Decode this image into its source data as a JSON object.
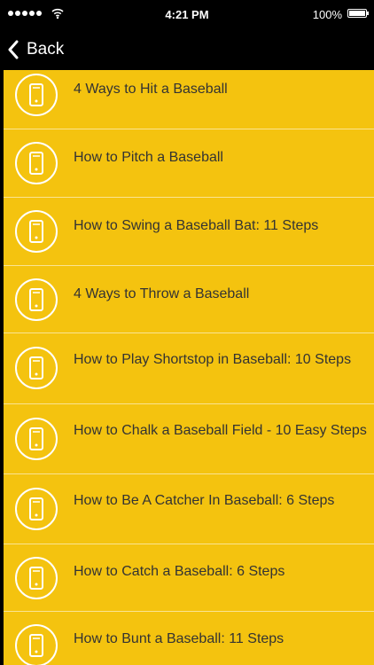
{
  "status_bar": {
    "time": "4:21 PM",
    "battery": "100%"
  },
  "nav": {
    "back_label": "Back"
  },
  "items": [
    {
      "label": "4 Ways to Hit a Baseball"
    },
    {
      "label": "How to Pitch a Baseball"
    },
    {
      "label": "How to Swing a Baseball Bat: 11 Steps"
    },
    {
      "label": "4 Ways to Throw a Baseball"
    },
    {
      "label": "How to Play Shortstop in Baseball: 10 Steps"
    },
    {
      "label": "How to Chalk a Baseball Field - 10 Easy Steps"
    },
    {
      "label": "How to Be A Catcher In Baseball: 6 Steps"
    },
    {
      "label": "How to Catch a Baseball: 6 Steps"
    },
    {
      "label": "How to Bunt a Baseball: 11 Steps"
    }
  ],
  "colors": {
    "list_background": "#F4C30F",
    "bar_background": "#000000",
    "text": "#333333"
  }
}
